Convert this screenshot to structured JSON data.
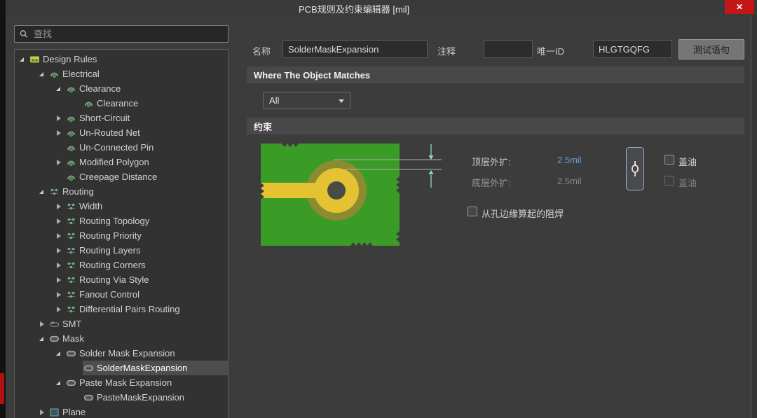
{
  "window": {
    "title": "PCB规则及约束编辑器 [mil]",
    "close_label": "✕"
  },
  "search": {
    "placeholder": "查找"
  },
  "tree": {
    "items": [
      {
        "label": "Design Rules"
      },
      {
        "label": "Electrical"
      },
      {
        "label": "Clearance"
      },
      {
        "label": "Clearance"
      },
      {
        "label": "Short-Circuit"
      },
      {
        "label": "Un-Routed Net"
      },
      {
        "label": "Un-Connected Pin"
      },
      {
        "label": "Modified Polygon"
      },
      {
        "label": "Creepage Distance"
      },
      {
        "label": "Routing"
      },
      {
        "label": "Width"
      },
      {
        "label": "Routing Topology"
      },
      {
        "label": "Routing Priority"
      },
      {
        "label": "Routing Layers"
      },
      {
        "label": "Routing Corners"
      },
      {
        "label": "Routing Via Style"
      },
      {
        "label": "Fanout Control"
      },
      {
        "label": "Differential Pairs Routing"
      },
      {
        "label": "SMT"
      },
      {
        "label": "Mask"
      },
      {
        "label": "Solder Mask Expansion"
      },
      {
        "label": "SolderMaskExpansion"
      },
      {
        "label": "Paste Mask Expansion"
      },
      {
        "label": "PasteMaskExpansion"
      },
      {
        "label": "Plane"
      }
    ],
    "selected_item": "SolderMaskExpansion"
  },
  "form": {
    "name_label": "名称",
    "name_value": "SolderMaskExpansion",
    "comment_label": "注释",
    "comment_value": "",
    "unique_id_label": "唯一ID",
    "unique_id_value": "HLGTGQFG",
    "test_query_label": "测试语句"
  },
  "matches": {
    "header": "Where The Object Matches",
    "scope_value": "All"
  },
  "constraints": {
    "header": "约束",
    "top_expansion_label": "顶层外扩:",
    "top_expansion_value": "2.5mil",
    "bottom_expansion_label": "底层外扩:",
    "bottom_expansion_value": "2.5mil",
    "tenting_top_label": "盖油",
    "tenting_bottom_label": "盖油",
    "from_hole_edge_label": "从孔边缘算起的阻焊"
  },
  "colors": {
    "board_green": "#3b9b27",
    "mask_ring_olive": "#8b8b2f",
    "pad_gold": "#e4c231",
    "hole_gray": "#4a4a46",
    "arrow_cyan": "#8fd8ca",
    "value_blue": "#6d9ed6",
    "close_red": "#c41616"
  }
}
